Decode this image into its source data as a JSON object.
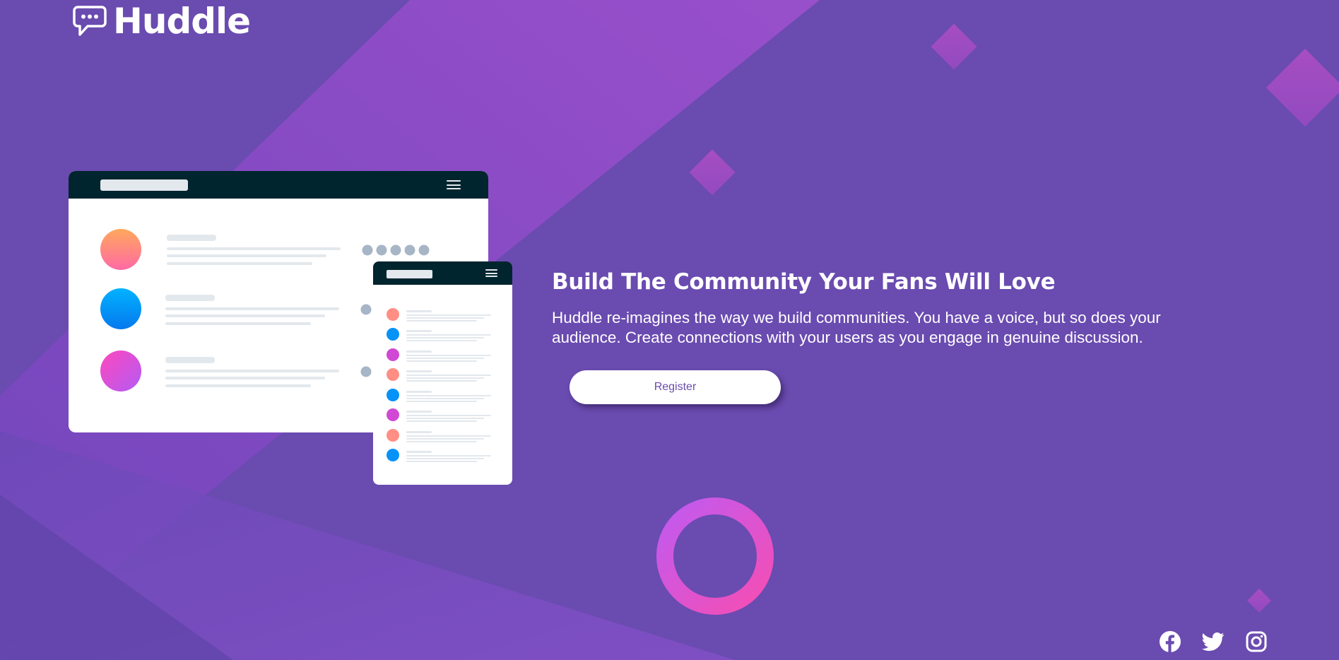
{
  "brand": {
    "name": "Huddle",
    "logo_icon": "chat-bubble-icon",
    "colors": {
      "background": "#6a4bb0",
      "background_light": "#9a4ecb",
      "accent_pink": "#f54eb3",
      "accent_violet": "#c15af0",
      "dark_bar": "#00252e",
      "white": "#ffffff"
    }
  },
  "hero": {
    "title": "Build The Community Your Fans Will Love",
    "text": "Huddle re-imagines the way we build communities. You have a voice, but so does your audience. Create connections with your users as you engage in genuine discussion.",
    "cta_label": "Register"
  },
  "mockup": {
    "desktop_menu_icon": "hamburger-icon",
    "mobile_menu_icon": "hamburger-icon"
  },
  "social": [
    {
      "name": "Facebook",
      "icon": "facebook-icon"
    },
    {
      "name": "Twitter",
      "icon": "twitter-icon"
    },
    {
      "name": "Instagram",
      "icon": "instagram-icon"
    }
  ]
}
